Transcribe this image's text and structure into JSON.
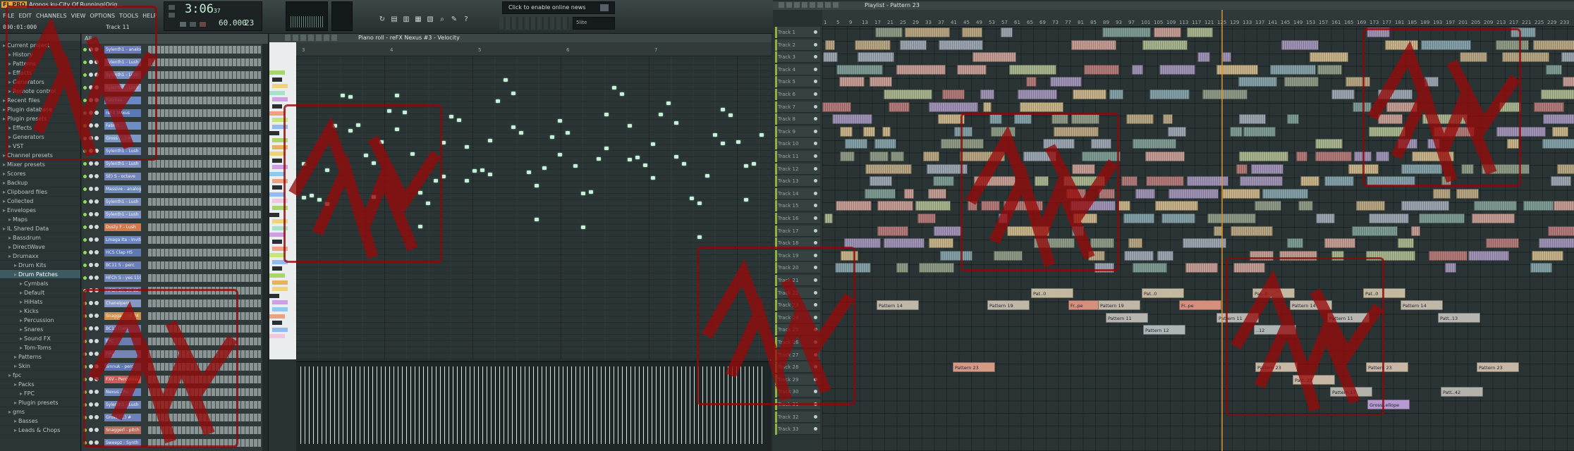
{
  "window": {
    "app_badge": "FL PRO",
    "title": "Aronos ku-City Of Running(Orig...",
    "time_display": "3:06",
    "time_small": "37",
    "tempo": "60.000",
    "pattern_number": "23",
    "hint_text": "000:01:000",
    "hint2_text": "Track 11",
    "news_text": "Click to enable online news",
    "cpu_text": "5lite"
  },
  "menu": [
    "FILE",
    "EDIT",
    "CHANNELS",
    "VIEW",
    "OPTIONS",
    "TOOLS",
    "HELP"
  ],
  "browser": {
    "items": [
      {
        "label": "Current project",
        "indent": 0
      },
      {
        "label": "History",
        "indent": 1
      },
      {
        "label": "Patterns",
        "indent": 1
      },
      {
        "label": "Effects",
        "indent": 1
      },
      {
        "label": "Generators",
        "indent": 1
      },
      {
        "label": "Remote control",
        "indent": 1
      },
      {
        "label": "Recent files",
        "indent": 0
      },
      {
        "label": "Plugin database",
        "indent": 0
      },
      {
        "label": "Plugin presets",
        "indent": 0
      },
      {
        "label": "Effects",
        "indent": 1
      },
      {
        "label": "Generators",
        "indent": 1
      },
      {
        "label": "VST",
        "indent": 1
      },
      {
        "label": "Channel presets",
        "indent": 0
      },
      {
        "label": "Mixer presets",
        "indent": 0
      },
      {
        "label": "Scores",
        "indent": 0
      },
      {
        "label": "Backup",
        "indent": 0
      },
      {
        "label": "Clipboard files",
        "indent": 0
      },
      {
        "label": "Collected",
        "indent": 0
      },
      {
        "label": "Envelopes",
        "indent": 0
      },
      {
        "label": "Maps",
        "indent": 1
      },
      {
        "label": "IL Shared Data",
        "indent": 0
      },
      {
        "label": "Bassdrum",
        "indent": 1
      },
      {
        "label": "DirectWave",
        "indent": 1
      },
      {
        "label": "Drumaxx",
        "indent": 1
      },
      {
        "label": "Drum Kits",
        "indent": 2
      },
      {
        "label": "Drum Patches",
        "indent": 2,
        "selected": true
      },
      {
        "label": "Cymbals",
        "indent": 3
      },
      {
        "label": "Default",
        "indent": 3
      },
      {
        "label": "HiHats",
        "indent": 3
      },
      {
        "label": "Kicks",
        "indent": 3
      },
      {
        "label": "Percussion",
        "indent": 3
      },
      {
        "label": "Snares",
        "indent": 3
      },
      {
        "label": "Sound FX",
        "indent": 3
      },
      {
        "label": "Tom-Toms",
        "indent": 3
      },
      {
        "label": "Patterns",
        "indent": 2
      },
      {
        "label": "Skin",
        "indent": 2
      },
      {
        "label": "fpc",
        "indent": 1
      },
      {
        "label": "Packs",
        "indent": 2
      },
      {
        "label": "FPC",
        "indent": 3
      },
      {
        "label": "Plugin presets",
        "indent": 2
      },
      {
        "label": "gms",
        "indent": 1
      },
      {
        "label": "Basses",
        "indent": 2
      },
      {
        "label": "Leads & Chops",
        "indent": 2
      }
    ]
  },
  "channel_rack": {
    "header": "All",
    "channels": [
      {
        "name": "Sylenth1 - analog",
        "color": "#6a7ab8"
      },
      {
        "name": "Sylenth1 - Lush",
        "color": "#7387c2"
      },
      {
        "name": "Sylenth1 - Lush",
        "color": "#7a8fc4"
      },
      {
        "name": "Sylenth1 - Lush",
        "color": "#8ca0ca"
      },
      {
        "name": "Patches",
        "color": "#6b88c6"
      },
      {
        "name": "reFX Nexus",
        "color": "#5c78b5"
      },
      {
        "name": "FabFilt...",
        "color": "#6f8dc5"
      },
      {
        "name": "Gross (...) #",
        "color": "#7a98c3"
      },
      {
        "name": "Sylenth1 - Lush",
        "color": "#6d83bc"
      },
      {
        "name": "Sylenth1 - Lush",
        "color": "#7b8fbf"
      },
      {
        "name": "SE) S - octave",
        "color": "#7283b8"
      },
      {
        "name": "Massive - analog",
        "color": "#6c8ab8"
      },
      {
        "name": "Sylenth1 - Lush",
        "color": "#7a8fbd"
      },
      {
        "name": "Sylenth1 - Lush",
        "color": "#8394c6"
      },
      {
        "name": "Dusty F - Lush",
        "color": "#d07a4e"
      },
      {
        "name": "Lmaga Ita - Invite",
        "color": "#6c86c3"
      },
      {
        "name": "HCS Clap HS",
        "color": "#5f77b3"
      },
      {
        "name": "BC11 5 - perc",
        "color": "#6b7fb6"
      },
      {
        "name": "HFCh S - yes 110",
        "color": "#7186bb"
      },
      {
        "name": "HFCh Sn. 20 85",
        "color": "#6f7eb2"
      },
      {
        "name": "Chanelperc",
        "color": "#8597c2"
      },
      {
        "name": "Snaggar - ra 24",
        "color": "#d0904e"
      },
      {
        "name": "BC13 Dam",
        "color": "#6f82b8"
      },
      {
        "name": "FPC",
        "color": "#6a7cb3"
      },
      {
        "name": "FPC",
        "color": "#7384b5"
      },
      {
        "name": "Sinnuk - perc",
        "color": "#5e75b0"
      },
      {
        "name": "FXV - Percussio",
        "color": "#cc5c5c"
      },
      {
        "name": "Nexus - Re",
        "color": "#6b84bb"
      },
      {
        "name": "Sylenth1 - Lush",
        "color": "#7387bd"
      },
      {
        "name": "Gross (...) #",
        "color": "#6f81b8"
      },
      {
        "name": "Snaggerl - pitch",
        "color": "#b96a5b"
      },
      {
        "name": "Sweepz - Synth",
        "color": "#6c7fb6"
      }
    ]
  },
  "piano_roll": {
    "title": "Piano roll - reFX Nexus #3 - Velocity",
    "bars": [
      "3",
      "4",
      "5",
      "6",
      "7"
    ]
  },
  "playlist": {
    "title": "Playlist - Pattern 23",
    "ruler": [
      "1",
      "5",
      "9",
      "13",
      "17",
      "21",
      "25",
      "29",
      "33",
      "37",
      "41",
      "45",
      "49",
      "53",
      "57",
      "61",
      "65",
      "69",
      "73",
      "77",
      "81",
      "85",
      "89",
      "93",
      "97",
      "101",
      "105",
      "109",
      "113",
      "117",
      "121",
      "125",
      "129",
      "133",
      "137",
      "141",
      "145",
      "149",
      "153",
      "157",
      "161",
      "165",
      "169",
      "173",
      "177",
      "181",
      "185",
      "189",
      "193",
      "197",
      "201",
      "205",
      "209",
      "213",
      "217",
      "221",
      "225",
      "229",
      "233"
    ],
    "tracks": [
      "Track 1",
      "Track 2",
      "Track 3",
      "Track 4",
      "Track 5",
      "Track 6",
      "Track 7",
      "Track 8",
      "Track 9",
      "Track 10",
      "Track 11",
      "Track 12",
      "Track 13",
      "Track 14",
      "Track 15",
      "Track 16",
      "Track 17",
      "Track 18",
      "Track 19",
      "Track 20",
      "Track 21",
      "Track 22",
      "Track 23",
      "Track 24",
      "Track 25",
      "Track 26",
      "Track 27",
      "Track 28",
      "Track 29",
      "Track 30",
      "Track 31",
      "Track 32",
      "Track 33"
    ],
    "pattern_clips": [
      {
        "track": 22,
        "label": "Pat..0",
        "color": "#c3b8a0"
      },
      {
        "track": 22,
        "label": "Pat..0",
        "color": "#c3b8a0"
      },
      {
        "track": 22,
        "label": "Pat..0",
        "color": "#c3b8a0"
      },
      {
        "track": 22,
        "label": "Pat..0",
        "color": "#c3b8a0"
      },
      {
        "track": 23,
        "label": "Fr..pe",
        "color": "#d58f7f"
      },
      {
        "track": 23,
        "label": "Fr..pe",
        "color": "#d58f7f"
      },
      {
        "track": 23,
        "label": "Pattern 14",
        "color": "#bfb7a8"
      },
      {
        "track": 23,
        "label": "Pattern 14",
        "color": "#bfb7a8"
      },
      {
        "track": 23,
        "label": "Pattern 14",
        "color": "#bfb7a8"
      },
      {
        "track": 23,
        "label": "Pattern 19",
        "color": "#bfb7a8"
      },
      {
        "track": 23,
        "label": "Pattern 19",
        "color": "#bfb7a8"
      },
      {
        "track": 24,
        "label": "Pattern 11",
        "color": "#b7b5b0"
      },
      {
        "track": 24,
        "label": "Pattern 11",
        "color": "#b7b5b0"
      },
      {
        "track": 24,
        "label": "Pattern 11",
        "color": "#b7b5b0"
      },
      {
        "track": 24,
        "label": "Patt..13",
        "color": "#b7b5b0"
      },
      {
        "track": 25,
        "label": "Pattern 12",
        "color": "#aeb5b7"
      },
      {
        "track": 25,
        "label": "..12",
        "color": "#aeb5b7"
      },
      {
        "track": 28,
        "label": "Pattern 23",
        "color": "#c7b7a4"
      },
      {
        "track": 28,
        "label": "Pattern 23",
        "color": "#c7b7a4"
      },
      {
        "track": 28,
        "label": "Pattern 23",
        "color": "#c7b7a4"
      },
      {
        "track": 28,
        "label": "Pattern 23",
        "color": "#d49a86"
      },
      {
        "track": 29,
        "label": "Patt..23",
        "color": "#c7b7a4"
      },
      {
        "track": 30,
        "label": "Pattern 17",
        "color": "#b4b3ab"
      },
      {
        "track": 30,
        "label": "Patt..42",
        "color": "#b4b3ab"
      },
      {
        "track": 31,
        "label": "Gross..ellope",
        "color": "#b69ad0"
      }
    ]
  },
  "colors": {
    "accent_green": "#6fb32f",
    "playhead": "#e2902e",
    "note": "#c8efd7",
    "watermark": "#8c0a0a"
  },
  "icons": [
    "play-icon",
    "stop-icon",
    "record-icon",
    "pattern-icon",
    "song-icon",
    "draw-icon",
    "paint-icon",
    "delete-icon",
    "mute-icon",
    "slip-icon",
    "slice-icon",
    "select-icon",
    "zoom-icon",
    "playback-icon",
    "mixer-icon",
    "browser-icon",
    "help-icon",
    "news-icon"
  ]
}
